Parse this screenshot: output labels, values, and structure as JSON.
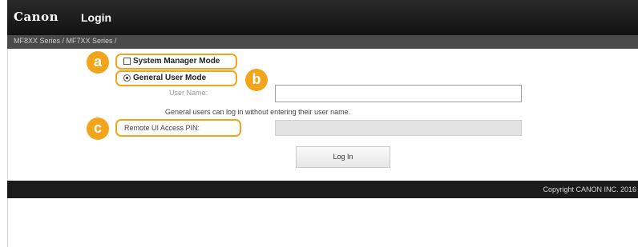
{
  "header": {
    "logo": "Canon",
    "title": "Login"
  },
  "breadcrumb": "MF8XX Series / MF7XX Series /",
  "login": {
    "modes": [
      {
        "label": "System Manager Mode",
        "selected": false
      },
      {
        "label": "General User Mode",
        "selected": true
      }
    ],
    "user_name_label": "User Name:",
    "user_name_value": "",
    "general_user_note": "General users can log in without entering their user name.",
    "pin_label": "Remote UI Access PIN:",
    "pin_value": "",
    "login_button": "Log In"
  },
  "callouts": {
    "a": "a",
    "b": "b",
    "c": "c"
  },
  "footer": {
    "copyright": "Copyright CANON INC. 2016"
  },
  "colors": {
    "accent": "#f2a51a",
    "header": "#111111",
    "footer": "#1b1b1b"
  }
}
